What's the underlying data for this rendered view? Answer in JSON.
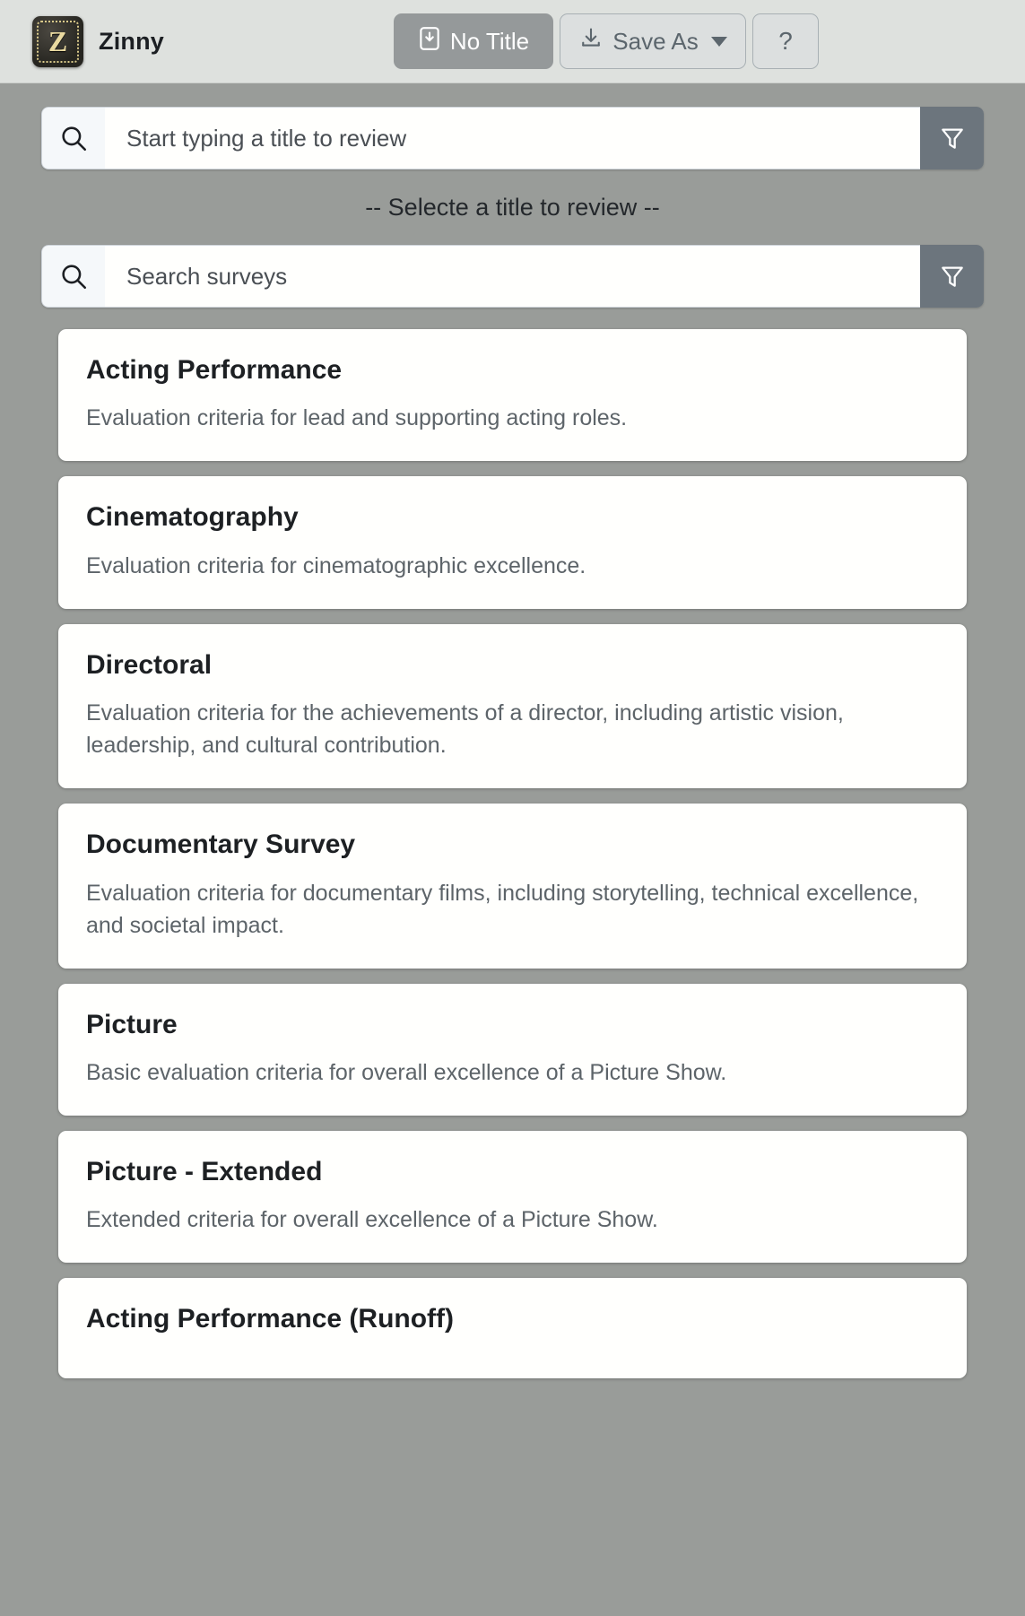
{
  "app": {
    "name": "Zinny",
    "logo_icon": "film-z-logo-icon",
    "accent_gray": "#6c757d",
    "topbar_bg": "#dee1de",
    "page_bg": "#999c99"
  },
  "toolbar": {
    "title_button": {
      "label": "No Title",
      "icon": "save-to-box-icon"
    },
    "save_as_button": {
      "label": "Save As",
      "icon": "download-tray-icon",
      "caret_icon": "chevron-down-icon"
    },
    "help_button": {
      "label": "?",
      "icon": "question-mark-icon"
    }
  },
  "title_search": {
    "placeholder": "Start typing a title to review",
    "value": "",
    "search_icon": "search-icon",
    "filter_icon": "filter-funnel-icon"
  },
  "hint": "-- Selecte a title to review --",
  "survey_search": {
    "placeholder": "Search surveys",
    "value": "",
    "search_icon": "search-icon",
    "filter_icon": "filter-funnel-icon"
  },
  "surveys": [
    {
      "title": "Acting Performance",
      "description": "Evaluation criteria for lead and supporting acting roles."
    },
    {
      "title": "Cinematography",
      "description": "Evaluation criteria for cinematographic excellence."
    },
    {
      "title": "Directoral",
      "description": "Evaluation criteria for the achievements of a director, including artistic vision, leadership, and cultural contribution."
    },
    {
      "title": "Documentary Survey",
      "description": "Evaluation criteria for documentary films, including storytelling, technical excellence, and societal impact."
    },
    {
      "title": "Picture",
      "description": "Basic evaluation criteria for overall excellence of a Picture Show."
    },
    {
      "title": "Picture - Extended",
      "description": "Extended criteria for overall excellence of a Picture Show."
    },
    {
      "title": "Acting Performance (Runoff)",
      "description": ""
    }
  ]
}
